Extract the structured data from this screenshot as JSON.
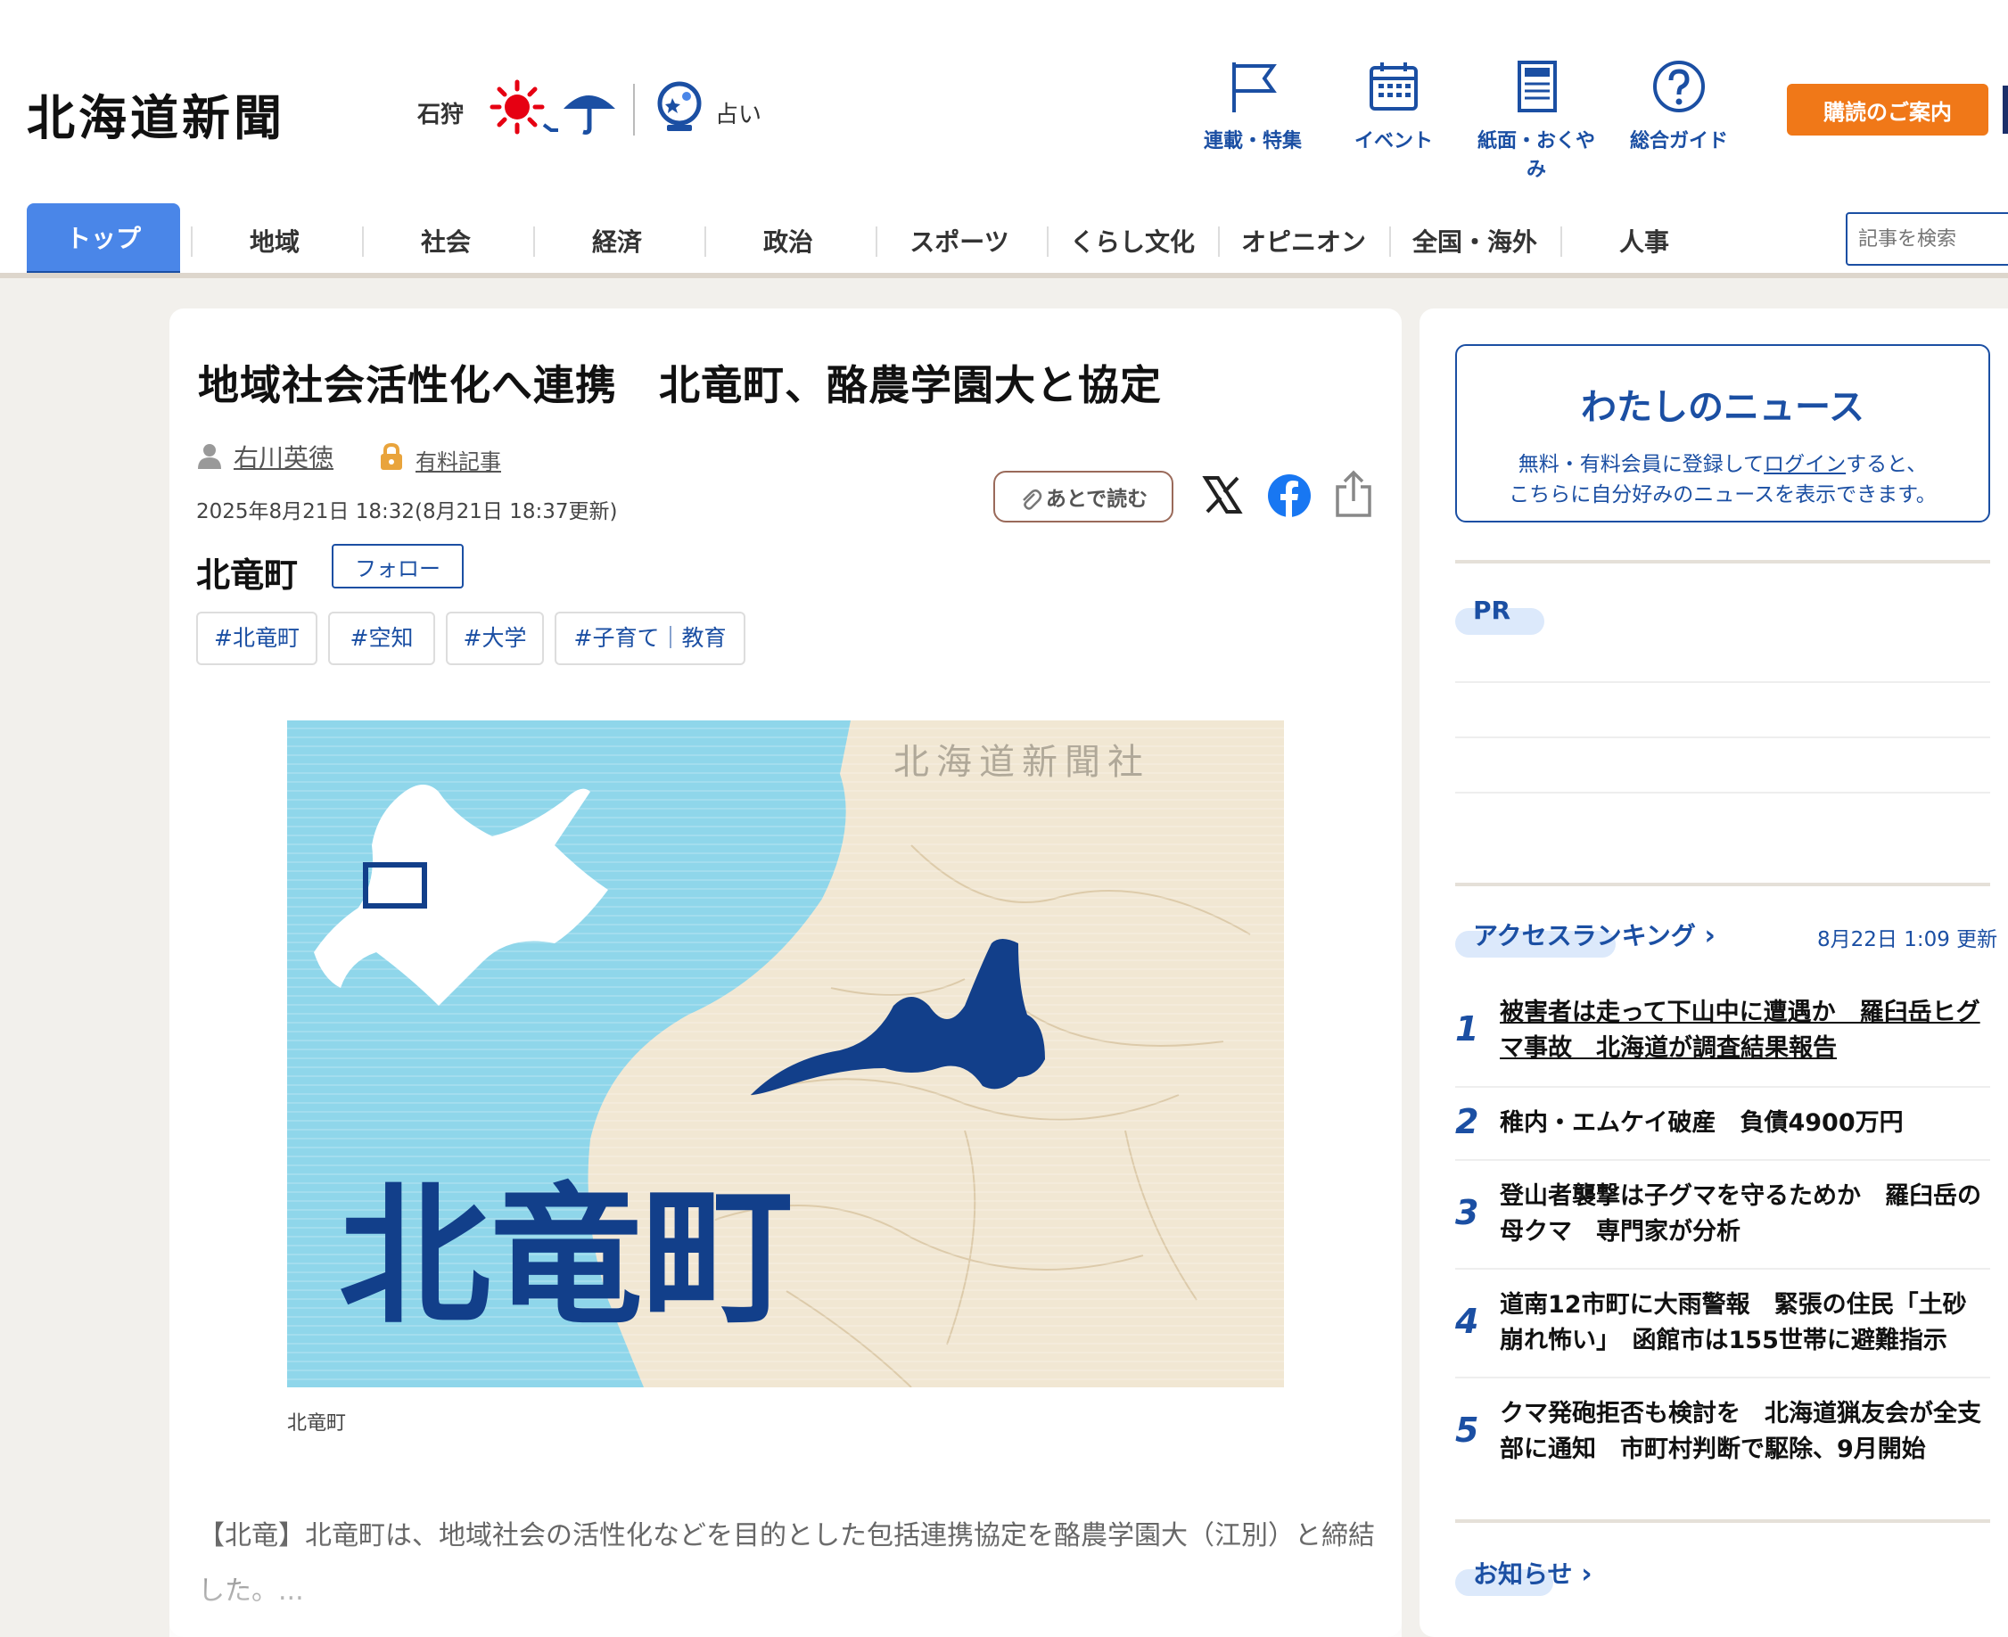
{
  "header": {
    "logo": "北海道新聞",
    "region": "石狩",
    "fortune": "占い",
    "nav_items": [
      {
        "label": "連載・特集",
        "icon": "flag-icon"
      },
      {
        "label": "イベント",
        "icon": "calendar-icon"
      },
      {
        "label": "紙面・おくやみ",
        "icon": "newspaper-icon"
      },
      {
        "label": "総合ガイド",
        "icon": "help-icon"
      }
    ],
    "subscribe": "購読のご案内"
  },
  "navbar": {
    "tabs": [
      "トップ",
      "地域",
      "社会",
      "経済",
      "政治",
      "スポーツ",
      "くらし文化",
      "オピニオン",
      "全国・海外",
      "人事"
    ],
    "search_placeholder": "記事を検索"
  },
  "article": {
    "title": "地域社会活性化へ連携　北竜町、酪農学園大と協定",
    "author": "右川英徳",
    "paid_label": "有料記事",
    "date": "2025年8月21日 18:32(8月21日 18:37更新)",
    "read_later": "あとで読む",
    "town": "北竜町",
    "follow": "フォロー",
    "tags": [
      "#北竜町",
      "#空知",
      "#大学",
      "#子育て｜教育"
    ],
    "figure": {
      "watermark": "北海道新聞社",
      "town_label": "北竜町",
      "colors": {
        "sea": "#8fd6ea",
        "land": "#f1e7d3",
        "town": "#123f8a"
      }
    },
    "caption": "北竜町",
    "lead": "【北竜】北竜町は、地域社会の活性化などを目的とした包括連携協定を酪農学園大（江別）と締結した。..."
  },
  "side": {
    "mynews": {
      "title": "わたしのニュース",
      "line1_pre": "無料・有料会員に登録して",
      "line1_link": "ログイン",
      "line1_post": "すると、",
      "line2": "こちらに自分好みのニュースを表示できます。"
    },
    "pr": "PR",
    "ranking": {
      "title": "アクセスランキング",
      "updated": "8月22日 1:09 更新",
      "items": [
        {
          "rank": "1",
          "text": "被害者は走って下山中に遭遇か　羅臼岳ヒグマ事故　北海道が調査結果報告"
        },
        {
          "rank": "2",
          "text": "稚内・エムケイ破産　負債4900万円"
        },
        {
          "rank": "3",
          "text": "登山者襲撃は子グマを守るためか　羅臼岳の母クマ　専門家が分析"
        },
        {
          "rank": "4",
          "text": "道南12市町に大雨警報　緊張の住民「土砂崩れ怖い」　函館市は155世帯に避難指示"
        },
        {
          "rank": "5",
          "text": "クマ発砲拒否も検討を　北海道猟友会が全支部に通知　市町村判断で駆除、9月開始"
        }
      ]
    },
    "notice": "お知らせ"
  },
  "colors": {
    "brand_blue": "#1b4fa3",
    "tab_active": "#4a86e8",
    "subscribe": "#f07818"
  }
}
